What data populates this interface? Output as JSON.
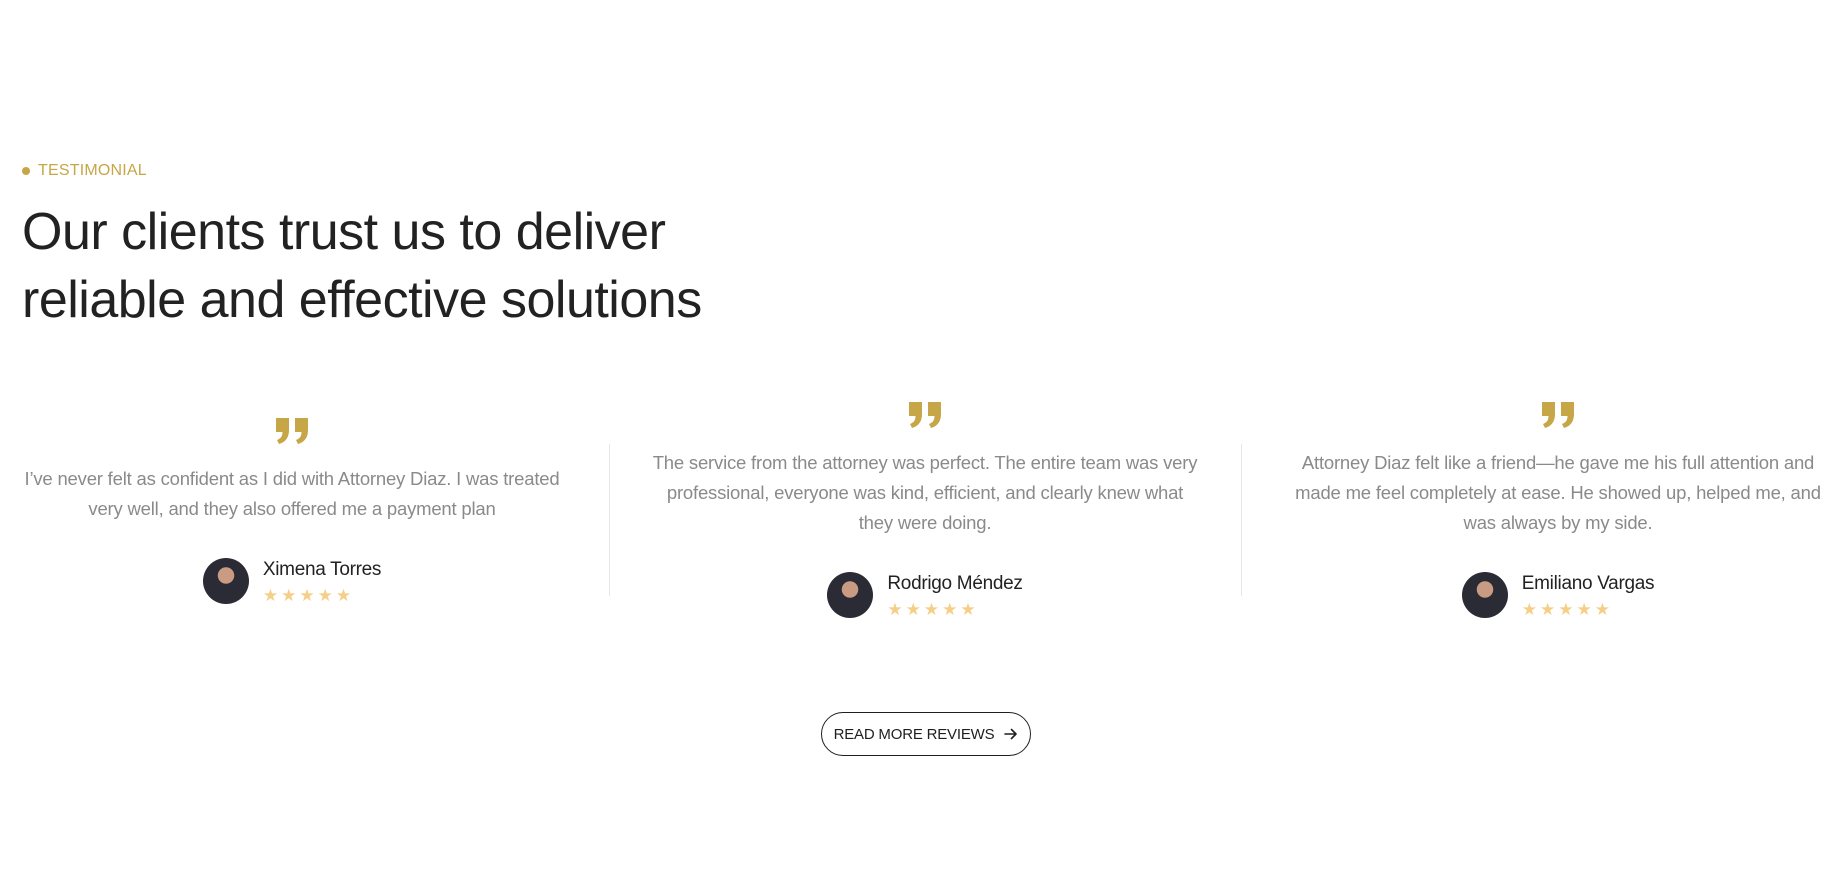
{
  "section": {
    "eyebrow": "TESTIMONIAL",
    "heading_line1": "Our clients trust us to deliver",
    "heading_line2": "reliable and effective solutions",
    "accent_color": "#c7a647",
    "star_color": "#f5cf88"
  },
  "testimonials": [
    {
      "quote": "I’ve never felt as confident as I did with Attorney Diaz. I was treated very well, and they also offered me a payment plan",
      "name": "Ximena Torres",
      "rating": 5
    },
    {
      "quote": "The service from the attorney was perfect. The entire team was very professional, everyone was kind, efficient, and clearly knew what they were doing.",
      "name": "Rodrigo Méndez",
      "rating": 5
    },
    {
      "quote": "Attorney Diaz felt like a friend—he gave me his full attention and made me feel completely at ease. He showed up, helped me, and was always by my side.",
      "name": "Emiliano Vargas",
      "rating": 5
    }
  ],
  "cta": {
    "label": "READ MORE REVIEWS",
    "icon": "arrow-right-icon"
  }
}
